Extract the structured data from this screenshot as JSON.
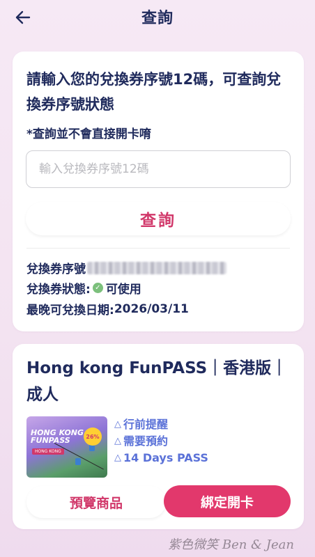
{
  "header": {
    "title": "查詢",
    "back_icon": "arrow-left-icon"
  },
  "query_card": {
    "instruction": "請輸入您的兌換券序號12碼，可查詢兌換券序號狀態",
    "note": "*查詢並不會直接開卡唷",
    "input": {
      "value": "",
      "placeholder": "輸入兌換券序號12碼"
    },
    "query_button": "查詢",
    "serial_label": "兌換券序號",
    "status_label": "兌換券狀態:",
    "status_value": "可使用",
    "status_color": "#7cc07c",
    "expiry_label": "最晚可兌換日期:",
    "expiry_value": "2026/03/11"
  },
  "product_card": {
    "title": "Hong kong FunPASS｜香港版｜成人",
    "thumbnail": {
      "title": "HONG KONG FUNPASS",
      "subtitle": "HONG KONG",
      "badge": "26%"
    },
    "tags": [
      "行前提醒",
      "需要預約",
      "14 Days PASS"
    ],
    "preview_button": "預覽商品",
    "bind_button": "綁定開卡",
    "accent_color": "#e2386c"
  },
  "watermark": "紫色微笑 Ben & Jean"
}
